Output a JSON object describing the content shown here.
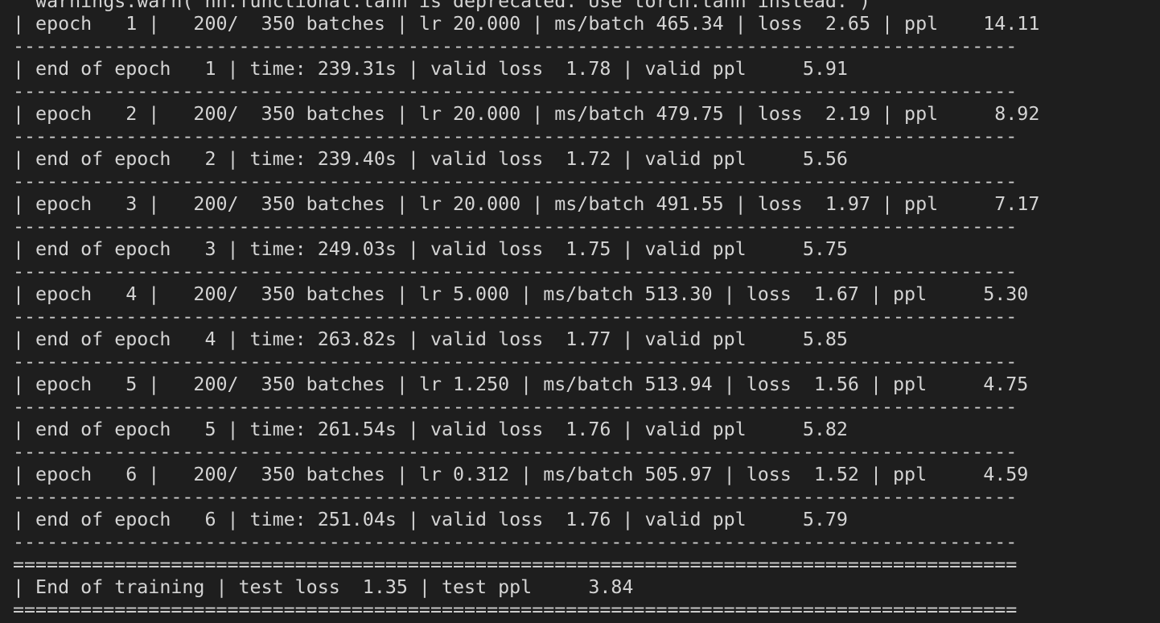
{
  "terminal": {
    "lines": [
      {
        "kind": "text",
        "text": "  warnings.warn(\"nn.functional.tanh is deprecated. Use torch.tanh instead.\")"
      },
      {
        "kind": "text",
        "text": "| epoch   1 |   200/  350 batches | lr 20.000 | ms/batch 465.34 | loss  2.65 | ppl    14.11"
      },
      {
        "kind": "sep",
        "text": "-----------------------------------------------------------------------------------------"
      },
      {
        "kind": "text",
        "text": "| end of epoch   1 | time: 239.31s | valid loss  1.78 | valid ppl     5.91"
      },
      {
        "kind": "sep",
        "text": "-----------------------------------------------------------------------------------------"
      },
      {
        "kind": "text",
        "text": "| epoch   2 |   200/  350 batches | lr 20.000 | ms/batch 479.75 | loss  2.19 | ppl     8.92"
      },
      {
        "kind": "sep",
        "text": "-----------------------------------------------------------------------------------------"
      },
      {
        "kind": "text",
        "text": "| end of epoch   2 | time: 239.40s | valid loss  1.72 | valid ppl     5.56"
      },
      {
        "kind": "sep",
        "text": "-----------------------------------------------------------------------------------------"
      },
      {
        "kind": "text",
        "text": "| epoch   3 |   200/  350 batches | lr 20.000 | ms/batch 491.55 | loss  1.97 | ppl     7.17"
      },
      {
        "kind": "sep",
        "text": "-----------------------------------------------------------------------------------------"
      },
      {
        "kind": "text",
        "text": "| end of epoch   3 | time: 249.03s | valid loss  1.75 | valid ppl     5.75"
      },
      {
        "kind": "sep",
        "text": "-----------------------------------------------------------------------------------------"
      },
      {
        "kind": "text",
        "text": "| epoch   4 |   200/  350 batches | lr 5.000 | ms/batch 513.30 | loss  1.67 | ppl     5.30"
      },
      {
        "kind": "sep",
        "text": "-----------------------------------------------------------------------------------------"
      },
      {
        "kind": "text",
        "text": "| end of epoch   4 | time: 263.82s | valid loss  1.77 | valid ppl     5.85"
      },
      {
        "kind": "sep",
        "text": "-----------------------------------------------------------------------------------------"
      },
      {
        "kind": "text",
        "text": "| epoch   5 |   200/  350 batches | lr 1.250 | ms/batch 513.94 | loss  1.56 | ppl     4.75"
      },
      {
        "kind": "sep",
        "text": "-----------------------------------------------------------------------------------------"
      },
      {
        "kind": "text",
        "text": "| end of epoch   5 | time: 261.54s | valid loss  1.76 | valid ppl     5.82"
      },
      {
        "kind": "sep",
        "text": "-----------------------------------------------------------------------------------------"
      },
      {
        "kind": "text",
        "text": "| epoch   6 |   200/  350 batches | lr 0.312 | ms/batch 505.97 | loss  1.52 | ppl     4.59"
      },
      {
        "kind": "sep",
        "text": "-----------------------------------------------------------------------------------------"
      },
      {
        "kind": "text",
        "text": "| end of epoch   6 | time: 251.04s | valid loss  1.76 | valid ppl     5.79"
      },
      {
        "kind": "sep",
        "text": "-----------------------------------------------------------------------------------------"
      },
      {
        "kind": "sep",
        "text": "========================================================================================="
      },
      {
        "kind": "text",
        "text": "| End of training | test loss  1.35 | test ppl     3.84"
      },
      {
        "kind": "sep",
        "text": "========================================================================================="
      }
    ]
  },
  "colors": {
    "background": "#1e1e1e",
    "text": "#d4d4d4"
  }
}
